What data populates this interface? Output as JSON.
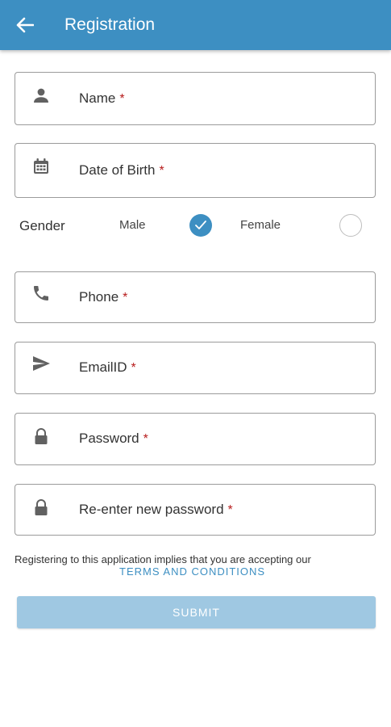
{
  "appbar": {
    "title": "Registration",
    "back_icon": "arrow-left-icon",
    "background_color": "#3d8fc2"
  },
  "form": {
    "required_marker": "*",
    "required_color": "#b71c1c",
    "name": {
      "label": "Name",
      "icon": "person-icon"
    },
    "dob": {
      "label": "Date of Birth",
      "icon": "calendar-icon"
    },
    "gender": {
      "label": "Gender",
      "options": [
        {
          "label": "Male",
          "selected": true
        },
        {
          "label": "Female",
          "selected": false
        }
      ]
    },
    "phone": {
      "label": "Phone",
      "icon": "phone-icon"
    },
    "email": {
      "label": "EmailID",
      "icon": "send-icon"
    },
    "password": {
      "label": "Password",
      "icon": "lock-icon"
    },
    "reenter_password": {
      "label": "Re-enter new password",
      "icon": "lock-icon"
    }
  },
  "terms": {
    "text": "Registering to this application implies that you are accepting our",
    "link": "TERMS AND CONDITIONS",
    "link_color": "#3d8fc2"
  },
  "submit": {
    "label": "SUBMIT",
    "state": "disabled",
    "color": "#9fc8e2"
  }
}
